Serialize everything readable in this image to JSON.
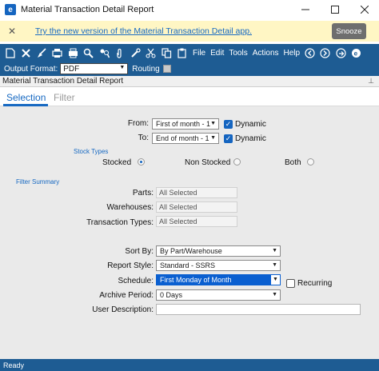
{
  "window": {
    "title": "Material Transaction Detail Report",
    "app_icon_letter": "e"
  },
  "banner": {
    "link_text": "Try the new version of the Material Transaction Detail app.",
    "snooze_label": "Snooze"
  },
  "toolbar": {
    "menus": [
      "File",
      "Edit",
      "Tools",
      "Actions",
      "Help"
    ]
  },
  "subbar": {
    "output_format_label": "Output Format:",
    "output_format_value": "PDF",
    "routing_label": "Routing"
  },
  "panel": {
    "title": "Material Transaction Detail Report"
  },
  "tabs": {
    "selection": "Selection",
    "filter": "Filter"
  },
  "form": {
    "from_label": "From:",
    "from_value": "First of month - 1",
    "to_label": "To:",
    "to_value": "End of month - 1",
    "dynamic_label": "Dynamic",
    "stock_types_label": "Stock Types",
    "stocked_label": "Stocked",
    "non_stocked_label": "Non Stocked",
    "both_label": "Both",
    "filter_summary_label": "Filter Summary",
    "parts_label": "Parts:",
    "parts_value": "All Selected",
    "warehouses_label": "Warehouses:",
    "warehouses_value": "All Selected",
    "transaction_types_label": "Transaction Types:",
    "transaction_types_value": "All Selected",
    "sort_by_label": "Sort By:",
    "sort_by_value": "By Part/Warehouse",
    "report_style_label": "Report Style:",
    "report_style_value": "Standard - SSRS",
    "schedule_label": "Schedule:",
    "schedule_value": "First Monday of Month",
    "recurring_label": "Recurring",
    "archive_period_label": "Archive Period:",
    "archive_period_value": "0 Days",
    "user_description_label": "User Description:",
    "user_description_value": ""
  },
  "status": {
    "text": "Ready"
  }
}
